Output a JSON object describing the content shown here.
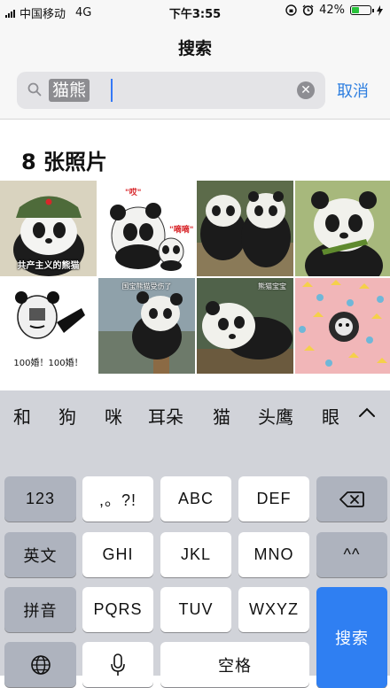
{
  "status_bar": {
    "carrier": "中国移动",
    "network": "4G",
    "time": "下午3:55",
    "battery_percent": "42%",
    "battery_level": 0.42
  },
  "nav": {
    "title": "搜索"
  },
  "search": {
    "query": "猫熊",
    "cancel_label": "取消"
  },
  "results": {
    "count_label": "8 张照片",
    "photos": [
      {
        "caption": "共产主义的熊猫",
        "top": ""
      },
      {
        "caption": "",
        "top": "",
        "stickers": [
          "\"哎\"",
          "\"嘀嘀\""
        ]
      },
      {
        "caption": "",
        "top": ""
      },
      {
        "caption": "",
        "top": ""
      },
      {
        "caption": "100婚！100婚！",
        "top": ""
      },
      {
        "caption": "",
        "top": "国宝熊猫受伤了"
      },
      {
        "caption": "",
        "top": "熊猫宝宝"
      },
      {
        "caption": "",
        "top": ""
      }
    ]
  },
  "keyboard": {
    "candidates": [
      "和",
      "狗",
      "咪",
      "耳朵",
      "猫",
      "头鹰",
      "眼"
    ],
    "row1": [
      "123",
      ",。?!",
      "ABC",
      "DEF"
    ],
    "row2": [
      "英文",
      "GHI",
      "JKL",
      "MNO",
      "^^"
    ],
    "row3": [
      "拼音",
      "PQRS",
      "TUV",
      "WXYZ"
    ],
    "row4": [
      "空格"
    ],
    "search_label": "搜索",
    "icons": [
      "backspace-icon",
      "globe-icon",
      "microphone-icon",
      "chevron-up-icon"
    ]
  },
  "colors": {
    "accent": "#2f7ff2",
    "battery": "#29c23b"
  }
}
